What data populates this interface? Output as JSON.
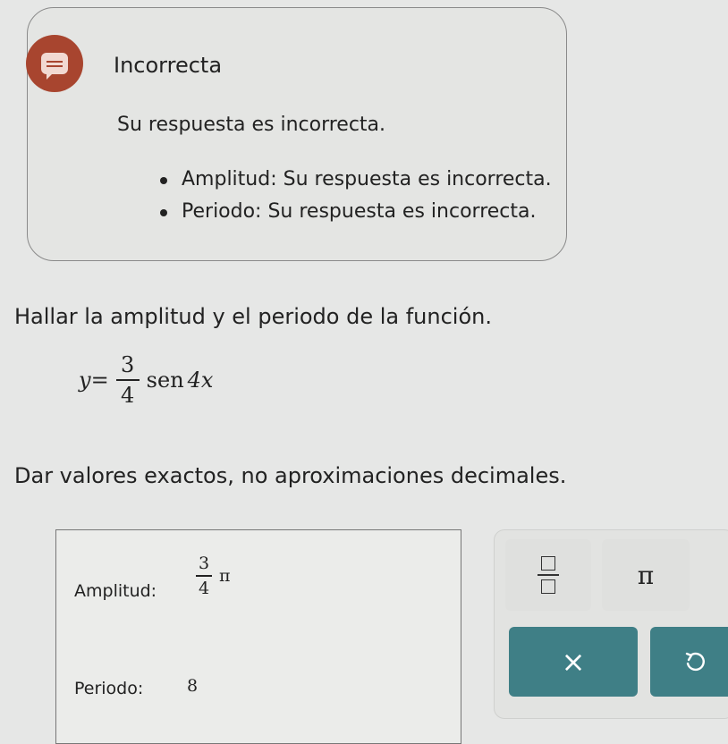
{
  "feedback": {
    "title": "Incorrecta",
    "message": "Su respuesta es incorrecta.",
    "items": [
      "Amplitud: Su respuesta es incorrecta.",
      "Periodo: Su respuesta es incorrecta."
    ],
    "icon": "feedback-bubble-icon",
    "accent_color": "#a8452f"
  },
  "question": "Hallar la amplitud y el periodo de la función.",
  "formula": {
    "lhs": "y",
    "equals": "=",
    "numerator": "3",
    "denominator": "4",
    "func": "sen",
    "argument": "4x"
  },
  "instructions": "Dar valores exactos, no aproximaciones decimales.",
  "answer": {
    "amplitude_label": "Amplitud:",
    "amplitude_numerator": "3",
    "amplitude_denominator": "4",
    "amplitude_suffix": "π",
    "period_label": "Periodo:",
    "period_value": "8"
  },
  "keypad": {
    "pi_label": "π",
    "clear_label": "×",
    "key_color": "#3f7f86"
  }
}
